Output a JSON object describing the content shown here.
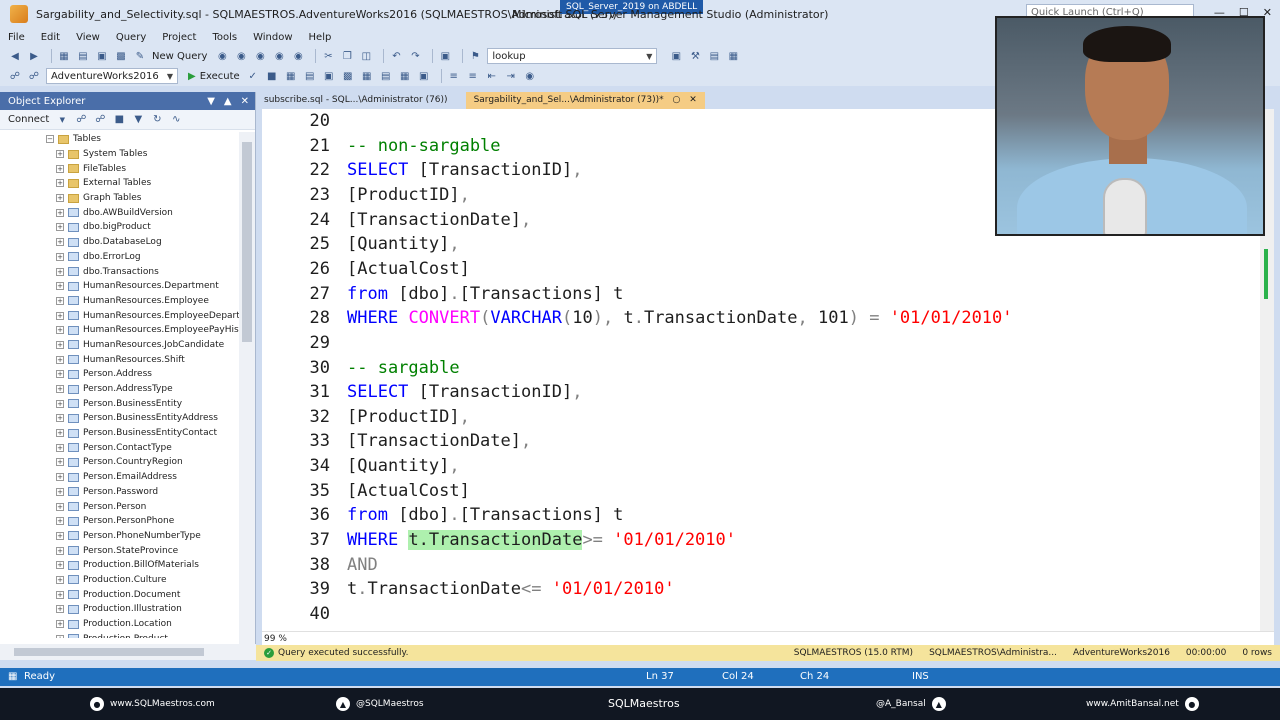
{
  "window": {
    "title": "Sargability_and_Selectivity.sql - SQLMAESTROS.AdventureWorks2016 (SQLMAESTROS\\Administrator (73)) - Microsoft SQL Server Management Studio (Administrator)",
    "title_short": "Sargability_and_Selectivity.sql - SQLMAESTROS.AdventureWorks2016 (SQLMAESTROS\\Administrator (73))",
    "title_app": "Microsoft SQL Server Management Studio (Administrator)",
    "center_badge": "SQL_Server_2019 on ABDELL",
    "quick_launch_placeholder": "Quick Launch (Ctrl+Q)"
  },
  "menu": [
    "File",
    "Edit",
    "View",
    "Query",
    "Project",
    "Tools",
    "Window",
    "Help"
  ],
  "toolbar": {
    "new_query": "New Query",
    "find_combo": "lookup",
    "database_combo": "AdventureWorks2016",
    "execute": "Execute"
  },
  "object_explorer": {
    "title": "Object Explorer",
    "connect": "Connect",
    "root": "Tables",
    "items": [
      "System Tables",
      "FileTables",
      "External Tables",
      "Graph Tables",
      "dbo.AWBuildVersion",
      "dbo.bigProduct",
      "dbo.DatabaseLog",
      "dbo.ErrorLog",
      "dbo.Transactions",
      "HumanResources.Department",
      "HumanResources.Employee",
      "HumanResources.EmployeeDepartm",
      "HumanResources.EmployeePayHisto",
      "HumanResources.JobCandidate",
      "HumanResources.Shift",
      "Person.Address",
      "Person.AddressType",
      "Person.BusinessEntity",
      "Person.BusinessEntityAddress",
      "Person.BusinessEntityContact",
      "Person.ContactType",
      "Person.CountryRegion",
      "Person.EmailAddress",
      "Person.Password",
      "Person.Person",
      "Person.PersonPhone",
      "Person.PhoneNumberType",
      "Person.StateProvince",
      "Production.BillOfMaterials",
      "Production.Culture",
      "Production.Document",
      "Production.Illustration",
      "Production.Location",
      "Production.Product"
    ]
  },
  "tabs": [
    {
      "label": "subscribe.sql - SQL...\\Administrator (76))",
      "active": false
    },
    {
      "label": "Sargability_and_Sel...\\Administrator (73))*",
      "active": true
    }
  ],
  "editor": {
    "lines": [
      {
        "n": "20",
        "tokens": []
      },
      {
        "n": "21",
        "tokens": [
          [
            "cm",
            "-- non-sargable"
          ]
        ]
      },
      {
        "n": "22",
        "tokens": [
          [
            "kw",
            "SELECT"
          ],
          [
            "tx",
            " [TransactionID]"
          ],
          [
            "gr",
            ","
          ]
        ]
      },
      {
        "n": "23",
        "tokens": [
          [
            "tx",
            "[ProductID]"
          ],
          [
            "gr",
            ","
          ]
        ]
      },
      {
        "n": "24",
        "tokens": [
          [
            "tx",
            "[TransactionDate]"
          ],
          [
            "gr",
            ","
          ]
        ]
      },
      {
        "n": "25",
        "tokens": [
          [
            "tx",
            "[Quantity]"
          ],
          [
            "gr",
            ","
          ]
        ]
      },
      {
        "n": "26",
        "tokens": [
          [
            "tx",
            "[ActualCost]"
          ]
        ]
      },
      {
        "n": "27",
        "tokens": [
          [
            "kw",
            "from"
          ],
          [
            "tx",
            " [dbo]"
          ],
          [
            "gr",
            "."
          ],
          [
            "tx",
            "[Transactions] t"
          ]
        ]
      },
      {
        "n": "28",
        "tokens": [
          [
            "kw",
            "WHERE"
          ],
          [
            "tx",
            " "
          ],
          [
            "fn",
            "CONVERT"
          ],
          [
            "gr",
            "("
          ],
          [
            "kw",
            "VARCHAR"
          ],
          [
            "gr",
            "("
          ],
          [
            "tx",
            "10"
          ],
          [
            "gr",
            "),"
          ],
          [
            "tx",
            " t"
          ],
          [
            "gr",
            "."
          ],
          [
            "tx",
            "TransactionDate"
          ],
          [
            "gr",
            ","
          ],
          [
            "tx",
            " 101"
          ],
          [
            "gr",
            ")"
          ],
          [
            "tx",
            " "
          ],
          [
            "gr",
            "="
          ],
          [
            "tx",
            " "
          ],
          [
            "str",
            "'01/01/2010'"
          ]
        ]
      },
      {
        "n": "29",
        "tokens": []
      },
      {
        "n": "30",
        "tokens": [
          [
            "cm",
            "-- sargable"
          ]
        ]
      },
      {
        "n": "31",
        "tokens": [
          [
            "kw",
            "SELECT"
          ],
          [
            "tx",
            " [TransactionID]"
          ],
          [
            "gr",
            ","
          ]
        ]
      },
      {
        "n": "32",
        "tokens": [
          [
            "tx",
            "[ProductID]"
          ],
          [
            "gr",
            ","
          ]
        ]
      },
      {
        "n": "33",
        "tokens": [
          [
            "tx",
            "[TransactionDate]"
          ],
          [
            "gr",
            ","
          ]
        ]
      },
      {
        "n": "34",
        "tokens": [
          [
            "tx",
            "[Quantity]"
          ],
          [
            "gr",
            ","
          ]
        ]
      },
      {
        "n": "35",
        "tokens": [
          [
            "tx",
            "[ActualCost]"
          ]
        ]
      },
      {
        "n": "36",
        "tokens": [
          [
            "kw",
            "from"
          ],
          [
            "tx",
            " [dbo]"
          ],
          [
            "gr",
            "."
          ],
          [
            "tx",
            "[Transactions] t"
          ]
        ]
      },
      {
        "n": "37",
        "tokens": [
          [
            "kw",
            "WHERE"
          ],
          [
            "tx",
            " "
          ],
          [
            "hl",
            "t.TransactionDate"
          ],
          [
            "gr",
            ">="
          ],
          [
            "tx",
            " "
          ],
          [
            "str",
            "'01/01/2010'"
          ]
        ]
      },
      {
        "n": "38",
        "tokens": [
          [
            "gr",
            "AND"
          ]
        ]
      },
      {
        "n": "39",
        "tokens": [
          [
            "tx",
            "t"
          ],
          [
            "gr",
            "."
          ],
          [
            "tx",
            "TransactionDate"
          ],
          [
            "gr",
            "<="
          ],
          [
            "tx",
            " "
          ],
          [
            "str",
            "'01/01/2010'"
          ]
        ]
      },
      {
        "n": "40",
        "tokens": []
      }
    ],
    "zoom": "99 %"
  },
  "query_status": {
    "message": "Query executed successfully.",
    "server": "SQLMAESTROS (15.0 RTM)",
    "user": "SQLMAESTROS\\Administra...",
    "database": "AdventureWorks2016",
    "elapsed": "00:00:00",
    "rows": "0 rows"
  },
  "statusbar": {
    "ready": "Ready",
    "ln": "Ln 37",
    "col": "Col 24",
    "ch": "Ch 24",
    "ins": "INS"
  },
  "banner": {
    "website": "www.SQLMaestros.com",
    "twitter1": "@SQLMaestros",
    "center": "SQLMaestros",
    "twitter2": "@A_Bansal",
    "website2": "www.AmitBansal.net"
  },
  "colors": {
    "accent": "#1f6fbd",
    "active_tab": "#f5cc84",
    "keyword": "#0000ff",
    "function": "#ff00ff",
    "comment": "#008000",
    "string": "#ff0000"
  }
}
